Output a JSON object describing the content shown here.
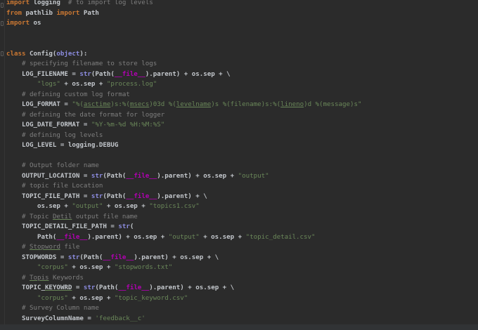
{
  "colors": {
    "background": "#2b2b2b",
    "keyword": "#cc7832",
    "comment": "#7f7f7f",
    "string": "#6a8759",
    "dunder": "#b200b2",
    "builtin": "#8c8ce0"
  },
  "code_lines": [
    [
      [
        "import",
        "kw"
      ],
      [
        " logging  ",
        "tx"
      ],
      [
        "# to import log levels",
        "cm"
      ]
    ],
    [
      [
        "from",
        "kw"
      ],
      [
        " pathlib ",
        "tx"
      ],
      [
        "import",
        "kw"
      ],
      [
        " Path",
        "tx"
      ]
    ],
    [
      [
        "import",
        "kw"
      ],
      [
        " os",
        "tx"
      ]
    ],
    [],
    [],
    [
      [
        "class",
        "kw"
      ],
      [
        " Config(",
        "tx"
      ],
      [
        "object",
        "bi"
      ],
      [
        "):",
        "tx"
      ]
    ],
    [
      [
        "    ",
        "tx"
      ],
      [
        "# specifying filename to store logs",
        "cm"
      ]
    ],
    [
      [
        "    LOG_FILENAME = ",
        "tx"
      ],
      [
        "str",
        "bi"
      ],
      [
        "(Path(",
        "tx"
      ],
      [
        "__file__",
        "dn"
      ],
      [
        ").parent) + os.sep + \\",
        "tx"
      ]
    ],
    [
      [
        "        ",
        "tx"
      ],
      [
        "\"logs\"",
        "str"
      ],
      [
        " + os.sep + ",
        "tx"
      ],
      [
        "\"process.log\"",
        "str"
      ]
    ],
    [
      [
        "    ",
        "tx"
      ],
      [
        "# defining custom log format",
        "cm"
      ]
    ],
    [
      [
        "    LOG_FORMAT = ",
        "tx"
      ],
      [
        "\"%(",
        "str"
      ],
      [
        "asctime",
        "stru"
      ],
      [
        ")s:%(",
        "str"
      ],
      [
        "msecs",
        "stru"
      ],
      [
        ")03d %(",
        "str"
      ],
      [
        "levelname",
        "stru"
      ],
      [
        ")s %(filename)s:%(",
        "str"
      ],
      [
        "lineno",
        "stru"
      ],
      [
        ")d %(message)s\"",
        "str"
      ]
    ],
    [
      [
        "    ",
        "tx"
      ],
      [
        "# defining the date format for logger",
        "cm"
      ]
    ],
    [
      [
        "    LOG_DATE_FORMAT = ",
        "tx"
      ],
      [
        "\"%Y-%m-%d %H:%M:%S\"",
        "str"
      ]
    ],
    [
      [
        "    ",
        "tx"
      ],
      [
        "# defining log levels",
        "cm"
      ]
    ],
    [
      [
        "    LOG_LEVEL = logging.DEBUG",
        "tx"
      ]
    ],
    [],
    [
      [
        "    ",
        "tx"
      ],
      [
        "# Output folder name",
        "cm"
      ]
    ],
    [
      [
        "    OUTPUT_LOCATION = ",
        "tx"
      ],
      [
        "str",
        "bi"
      ],
      [
        "(Path(",
        "tx"
      ],
      [
        "__file__",
        "dn"
      ],
      [
        ").parent) + os.sep + ",
        "tx"
      ],
      [
        "\"output\"",
        "str"
      ]
    ],
    [
      [
        "    ",
        "tx"
      ],
      [
        "# topic file Location",
        "cm"
      ]
    ],
    [
      [
        "    TOPIC_FILE_PATH = ",
        "tx"
      ],
      [
        "str",
        "bi"
      ],
      [
        "(Path(",
        "tx"
      ],
      [
        "__file__",
        "dn"
      ],
      [
        ").parent) + \\",
        "tx"
      ]
    ],
    [
      [
        "        os.sep + ",
        "tx"
      ],
      [
        "\"output\"",
        "str"
      ],
      [
        " + os.sep + ",
        "tx"
      ],
      [
        "\"topics1.csv\"",
        "str"
      ]
    ],
    [
      [
        "    ",
        "tx"
      ],
      [
        "# Topic ",
        "cm"
      ],
      [
        "Detil",
        "cmu"
      ],
      [
        " output file name",
        "cm"
      ]
    ],
    [
      [
        "    TOPIC_DETAIL_FILE_PATH = ",
        "tx"
      ],
      [
        "str",
        "bi"
      ],
      [
        "(",
        "tx"
      ]
    ],
    [
      [
        "        Path(",
        "tx"
      ],
      [
        "__file__",
        "dn"
      ],
      [
        ").parent) + os.sep + ",
        "tx"
      ],
      [
        "\"output\"",
        "str"
      ],
      [
        " + os.sep + ",
        "tx"
      ],
      [
        "\"topic_detail.csv\"",
        "str"
      ]
    ],
    [
      [
        "    ",
        "tx"
      ],
      [
        "# ",
        "cm"
      ],
      [
        "Stopword",
        "cmu"
      ],
      [
        " file",
        "cm"
      ]
    ],
    [
      [
        "    STOPWORDS = ",
        "tx"
      ],
      [
        "str",
        "bi"
      ],
      [
        "(Path(",
        "tx"
      ],
      [
        "__file__",
        "dn"
      ],
      [
        ").parent) + os.sep + \\",
        "tx"
      ]
    ],
    [
      [
        "        ",
        "tx"
      ],
      [
        "\"corpus\"",
        "str"
      ],
      [
        " + os.sep + ",
        "tx"
      ],
      [
        "\"stopwords.txt\"",
        "str"
      ]
    ],
    [
      [
        "    ",
        "tx"
      ],
      [
        "# ",
        "cm"
      ],
      [
        "Topis",
        "cmu"
      ],
      [
        " Keywords",
        "cm"
      ]
    ],
    [
      [
        "    TOPIC_",
        "tx"
      ],
      [
        "KEYOWRD",
        "txu"
      ],
      [
        " = ",
        "tx"
      ],
      [
        "str",
        "bi"
      ],
      [
        "(Path(",
        "tx"
      ],
      [
        "__file__",
        "dn"
      ],
      [
        ").parent) + os.sep + \\",
        "tx"
      ]
    ],
    [
      [
        "        ",
        "tx"
      ],
      [
        "\"corpus\"",
        "str"
      ],
      [
        " + os.sep + ",
        "tx"
      ],
      [
        "\"topic_keyword.csv\"",
        "str"
      ]
    ],
    [
      [
        "    ",
        "tx"
      ],
      [
        "# Survey Column name",
        "cm"
      ]
    ],
    [
      [
        "    SurveyColumnName = ",
        "tx"
      ],
      [
        "'feedback__c'",
        "str"
      ]
    ]
  ]
}
